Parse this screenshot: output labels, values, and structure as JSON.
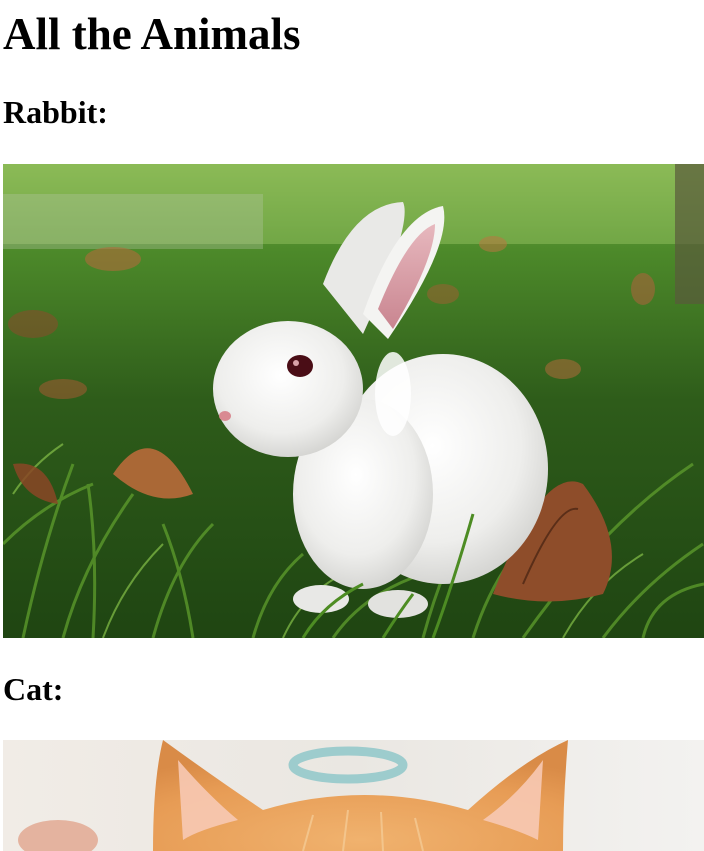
{
  "page": {
    "title": "All the Animals"
  },
  "sections": [
    {
      "heading": "Rabbit:",
      "image_subject": "rabbit"
    },
    {
      "heading": "Cat:",
      "image_subject": "cat"
    }
  ],
  "colors": {
    "text": "#000000",
    "background": "#ffffff",
    "grass": "#3f7a20",
    "rabbit_fur": "#f2f2f0",
    "cat_fur": "#e9a25e"
  }
}
